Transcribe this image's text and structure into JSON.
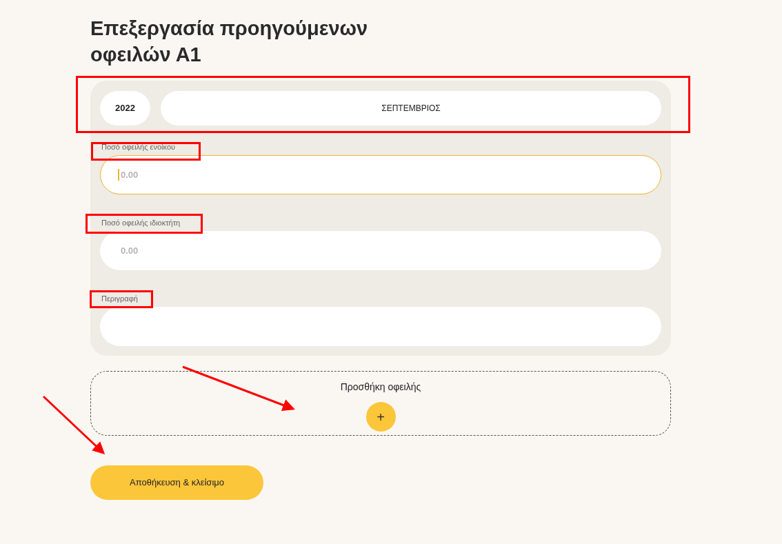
{
  "title": "Επεξεργασία προηγούμενων οφειλών Α1",
  "period": {
    "year": "2022",
    "month": "ΣΕΠΤΕΜΒΡΙΟΣ"
  },
  "fields": [
    {
      "label": "Ποσό οφειλής ενοίκου",
      "placeholder": "0.00",
      "focused": true
    },
    {
      "label": "Ποσό οφειλής ιδιοκτήτη",
      "placeholder": "0.00",
      "focused": false
    },
    {
      "label": "Περιγραφή",
      "focused": false
    }
  ],
  "add_debt": {
    "label": "Προσθήκη οφειλής",
    "button": "+"
  },
  "save_button": "Αποθήκευση & κλείσιμο"
}
